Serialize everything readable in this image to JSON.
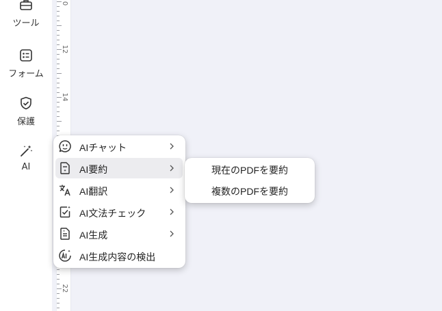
{
  "sidebar": {
    "items": [
      {
        "label": "ツール",
        "icon": "toolbox-icon"
      },
      {
        "label": "フォーム",
        "icon": "form-icon"
      },
      {
        "label": "保護",
        "icon": "shield-icon"
      },
      {
        "label": "AI",
        "icon": "magic-wand-icon"
      }
    ]
  },
  "ruler": {
    "labels": [
      "0",
      "12",
      "14",
      "22"
    ]
  },
  "ai_menu": {
    "items": [
      {
        "label": "AIチャット",
        "icon": "chat-bubble-icon",
        "has_submenu": true
      },
      {
        "label": "AI要約",
        "icon": "summary-doc-icon",
        "has_submenu": true,
        "active": true
      },
      {
        "label": "AI翻訳",
        "icon": "translate-icon",
        "has_submenu": true
      },
      {
        "label": "AI文法チェック",
        "icon": "grammar-check-icon",
        "has_submenu": true
      },
      {
        "label": "AI生成",
        "icon": "generate-doc-icon",
        "has_submenu": true
      },
      {
        "label": "AI生成内容の検出",
        "icon": "ai-detect-icon",
        "has_submenu": false
      }
    ]
  },
  "summary_submenu": {
    "items": [
      {
        "label": "現在のPDFを要約"
      },
      {
        "label": "複数のPDFを要約"
      }
    ]
  },
  "colors": {
    "canvas_bg": "#f0f1f8",
    "hover_bg": "#ececef",
    "icon": "#333333"
  }
}
